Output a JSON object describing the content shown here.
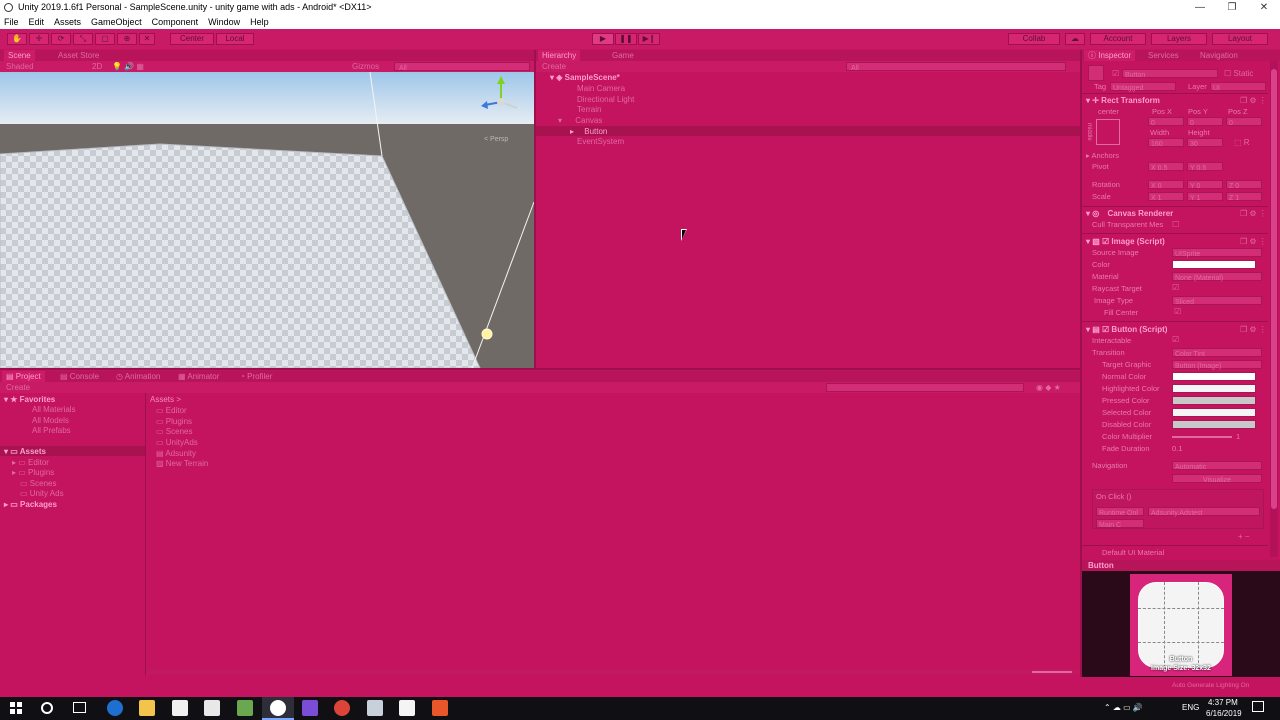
{
  "window": {
    "title": "Unity 2019.1.6f1 Personal - SampleScene.unity - unity game with ads - Android* <DX11>",
    "controls": [
      "—",
      "❐",
      "✕"
    ]
  },
  "menu": [
    "File",
    "Edit",
    "Assets",
    "GameObject",
    "Component",
    "Window",
    "Help"
  ],
  "toolbar": {
    "pivot": "Center",
    "space": "Local",
    "collab": "Collab",
    "account": "Account",
    "layers": "Layers",
    "layout": "Layout"
  },
  "scene": {
    "tabs": [
      "Scene",
      "Asset Store"
    ],
    "shading": "Shaded",
    "mode2d": "2D",
    "gizmos": "Gizmos",
    "search_placeholder": "All",
    "persp": "< Persp"
  },
  "hierarchy": {
    "tabs": [
      "Hierarchy",
      "Game"
    ],
    "create": "Create",
    "search_placeholder": "All",
    "scene_name": "SampleScene*",
    "items": [
      "Main Camera",
      "Directional Light",
      "Terrain",
      "Canvas",
      "Button",
      "EventSystem"
    ]
  },
  "project": {
    "tabs": [
      "Project",
      "Console",
      "Animation",
      "Animator",
      "Profiler"
    ],
    "create": "Create",
    "favorites": "Favorites",
    "favorite_items": [
      "All Materials",
      "All Models",
      "All Prefabs"
    ],
    "assets_root": "Assets",
    "asset_tree": [
      "Editor",
      "Plugins",
      "Scenes",
      "Unity Ads"
    ],
    "packages": "Packages",
    "breadcrumb": "Assets >",
    "asset_items": [
      "Editor",
      "Plugins",
      "Scenes",
      "UnityAds",
      "Adsunity",
      "New Terrain"
    ]
  },
  "inspector": {
    "tabs": [
      "Inspector",
      "Services",
      "Navigation"
    ],
    "object_name": "Button",
    "static_label": "Static",
    "tag_label": "Tag",
    "tag_value": "Untagged",
    "layer_label": "Layer",
    "layer_value": "UI",
    "rect_transform": "Rect Transform",
    "anchor_label": "center",
    "middle_label": "middle",
    "pos_labels": [
      "Pos X",
      "Pos Y",
      "Pos Z"
    ],
    "pos_values": [
      "0",
      "0",
      "0"
    ],
    "size_labels": [
      "Width",
      "Height"
    ],
    "size_values": [
      "160",
      "30"
    ],
    "anchors": "Anchors",
    "pivot_label": "Pivot",
    "pivot_values": [
      "X 0.5",
      "Y 0.5"
    ],
    "rotation_label": "Rotation",
    "rotation_values": [
      "X 0",
      "Y 0",
      "Z 0"
    ],
    "scale_label": "Scale",
    "scale_values": [
      "X 1",
      "Y 1",
      "Z 1"
    ],
    "canvas_renderer": "Canvas Renderer",
    "cull_transparent": "Cull Transparent Mes",
    "image_script": "Image (Script)",
    "source_image_label": "Source Image",
    "source_image_value": "UISprite",
    "color_label": "Color",
    "material_label": "Material",
    "material_value": "None (Material)",
    "raycast_label": "Raycast Target",
    "image_type_label": "Image Type",
    "image_type_value": "Sliced",
    "fill_center_label": "Fill Center",
    "button_script": "Button (Script)",
    "interactable_label": "Interactable",
    "transition_label": "Transition",
    "transition_value": "Color Tint",
    "target_graphic_label": "Target Graphic",
    "target_graphic_value": "Button (Image)",
    "normal_color": "Normal Color",
    "highlighted_color": "Highlighted Color",
    "pressed_color": "Pressed Color",
    "selected_color": "Selected Color",
    "disabled_color": "Disabled Color",
    "color_multiplier": "Color Multiplier",
    "color_multiplier_value": "1",
    "fade_duration": "Fade Duration",
    "fade_duration_value": "0.1",
    "navigation_label": "Navigation",
    "navigation_value": "Automatic",
    "visualize": "Visualize",
    "on_click": "On Click ()",
    "runtime_only": "Runtime Onl",
    "function_value": "Adsunity.Adstest",
    "object_value": "Main C",
    "default_material": "Default UI Material",
    "preview_title": "Button",
    "preview_caption": "Button",
    "preview_size": "Image Size: 32x32"
  },
  "status": {
    "auto_generate": "Auto Generate Lighting On"
  },
  "taskbar": {
    "time": "4:37 PM",
    "date": "6/16/2019",
    "lang": "ENG"
  },
  "colors": {
    "background": "#c4135f",
    "header": "#b8145a",
    "text": "#e06aa0",
    "highlight_text": "#ff9fd0"
  }
}
